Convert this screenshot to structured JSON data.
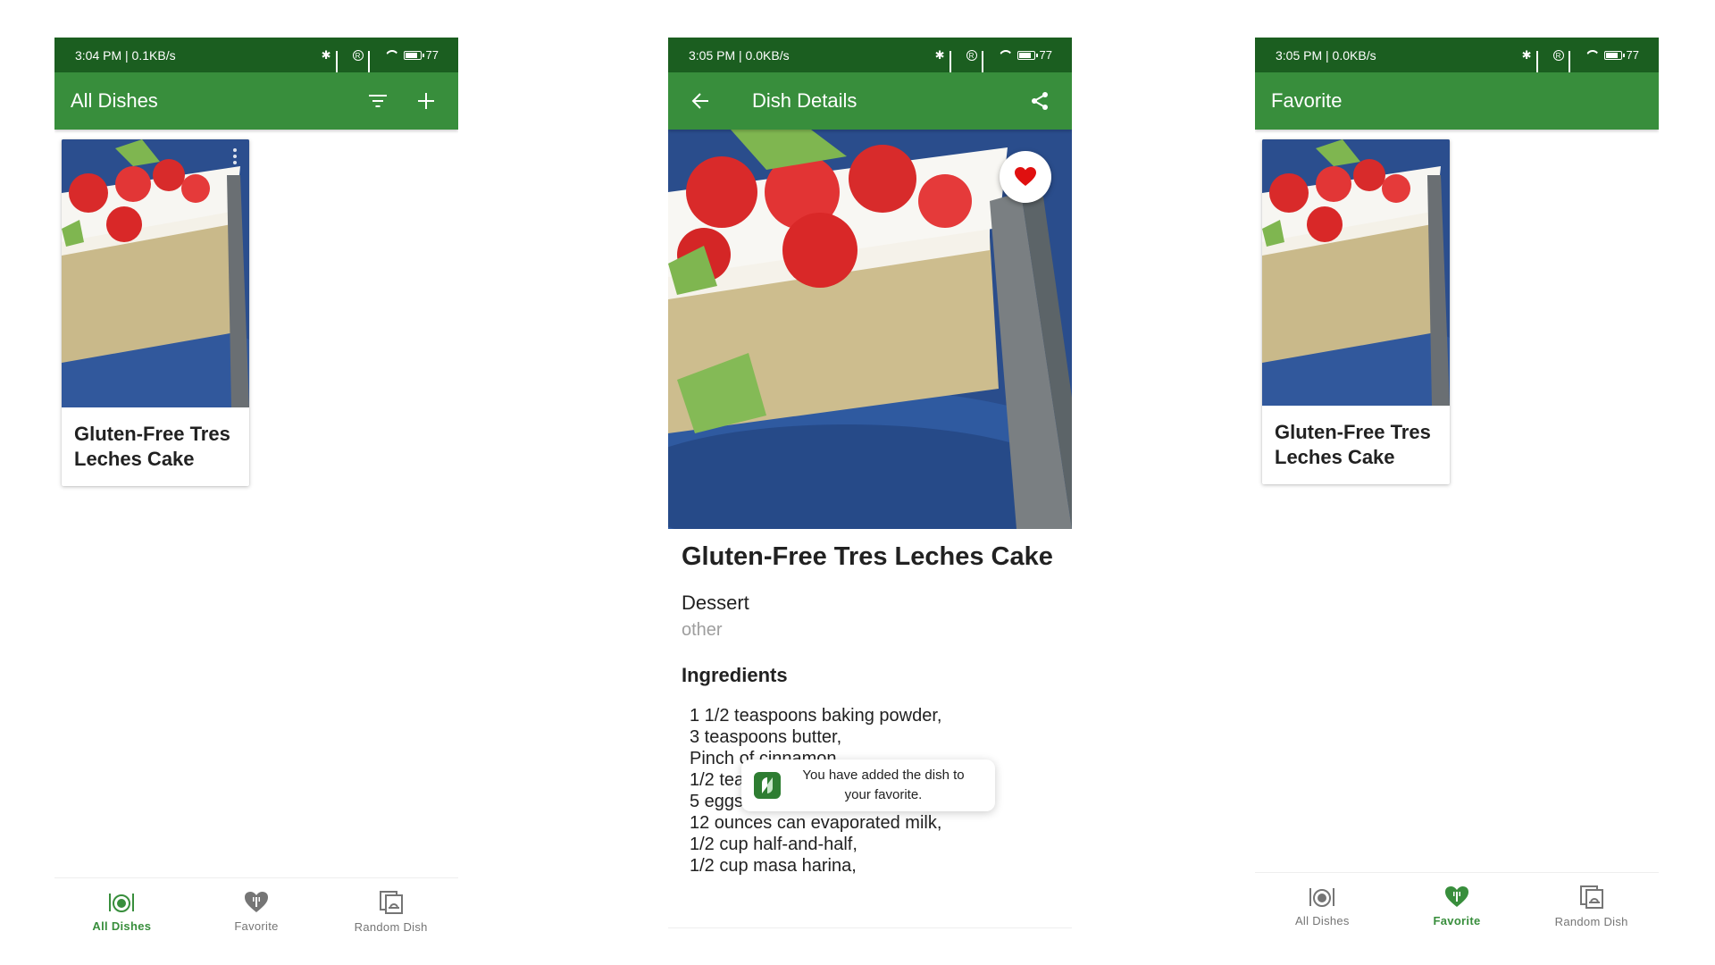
{
  "screens": [
    {
      "status": {
        "time": "3:04 PM | 0.1KB/s",
        "battery": "77"
      },
      "appbar": {
        "title": "All Dishes",
        "icons": [
          "filter-icon",
          "add-icon"
        ]
      },
      "dish_card": {
        "title": "Gluten-Free Tres Leches Cake"
      },
      "bottom_nav": {
        "active": 0,
        "items": [
          "All Dishes",
          "Favorite",
          "Random Dish"
        ]
      }
    },
    {
      "status": {
        "time": "3:05 PM | 0.0KB/s",
        "battery": "77"
      },
      "appbar": {
        "title": "Dish Details",
        "icons": [
          "back-arrow-icon",
          "share-icon"
        ]
      },
      "detail": {
        "title": "Gluten-Free Tres Leches Cake",
        "type": "Dessert",
        "category": "other",
        "ingredients_heading": "Ingredients",
        "ingredients": [
          "1 1/2 teaspoons baking powder,",
          "3 teaspoons butter,",
          "Pinch of cinnamon,",
          "1/2 tea",
          "5 eggs,",
          "12 ounces can evaporated milk,",
          "1/2 cup half-and-half,",
          "1/2 cup masa harina,"
        ],
        "favorite": true
      },
      "toast": {
        "line1": "You have added the dish to",
        "line2": "your favorite."
      }
    },
    {
      "status": {
        "time": "3:05 PM | 0.0KB/s",
        "battery": "77"
      },
      "appbar": {
        "title": "Favorite",
        "icons": []
      },
      "dish_card": {
        "title": "Gluten-Free Tres Leches Cake"
      },
      "bottom_nav": {
        "active": 1,
        "items": [
          "All Dishes",
          "Favorite",
          "Random Dish"
        ]
      }
    }
  ],
  "colors": {
    "status_bar": "#1b5e20",
    "app_bar": "#388e3c",
    "accent": "#388e3c",
    "favorite_heart": "#e01010"
  }
}
